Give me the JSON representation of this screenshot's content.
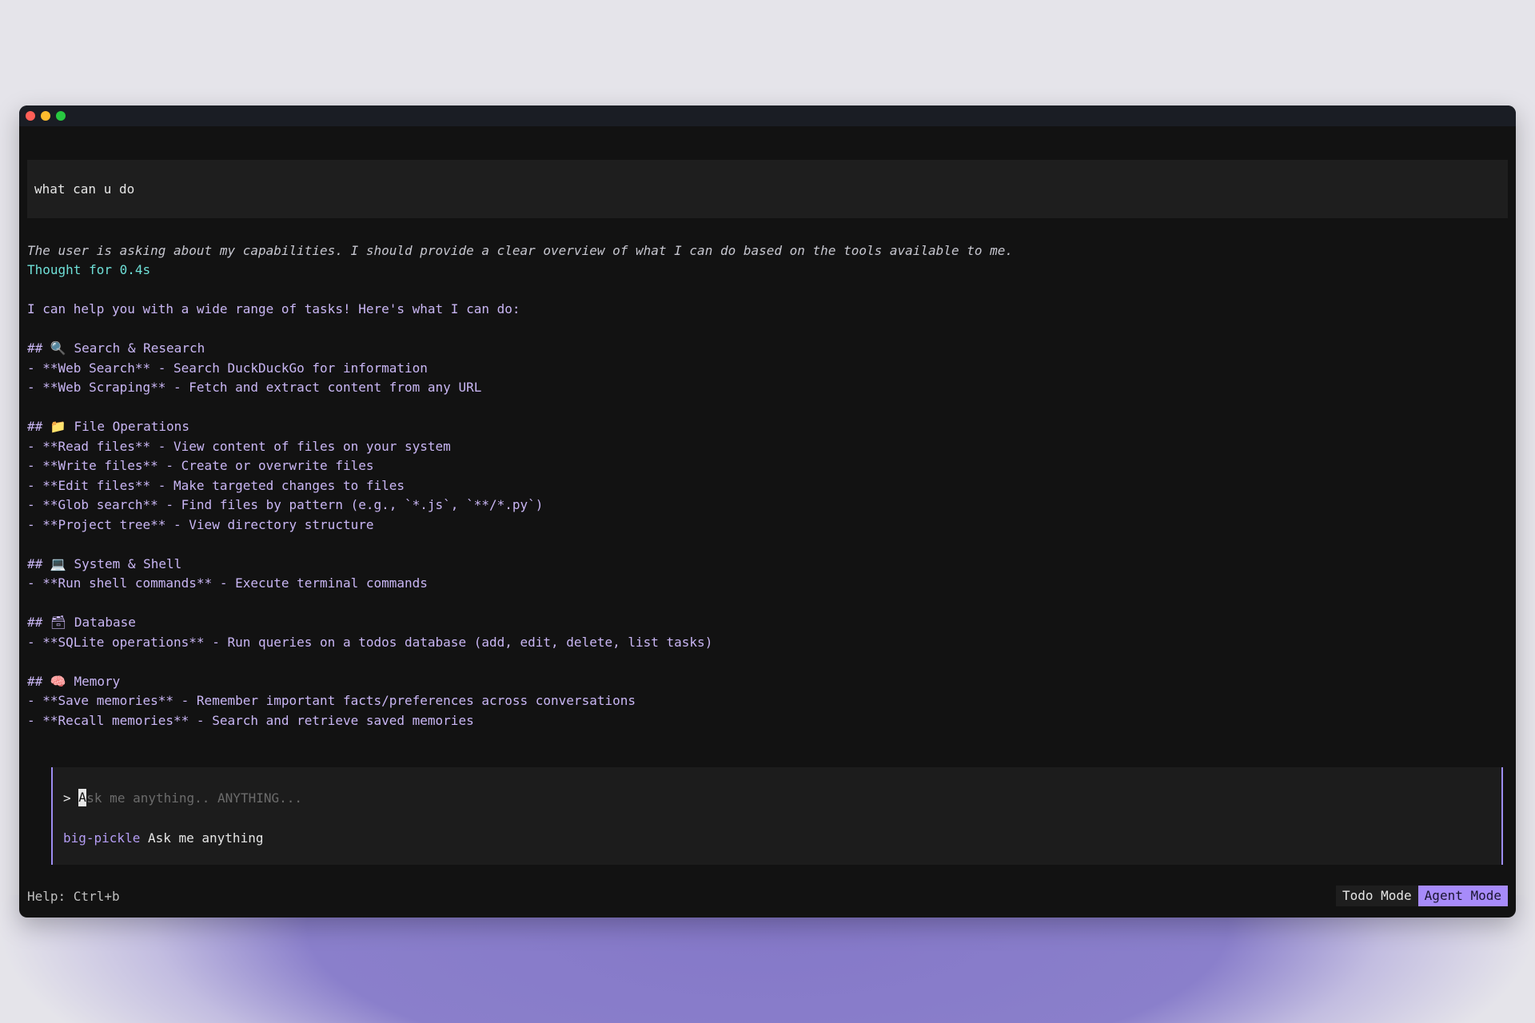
{
  "colors": {
    "accent": "#a78bfa",
    "response_text": "#c9b6f4",
    "thought_time": "#6fe0d8",
    "window_bg": "#121212"
  },
  "conversation": {
    "user_message": "what can u do",
    "thought": "The user is asking about my capabilities. I should provide a clear overview of what I can do based on the tools available to me.",
    "thought_time": "Thought for 0.4s",
    "response_lines": [
      "I can help you with a wide range of tasks! Here's what I can do:",
      "",
      "## 🔍 Search & Research",
      "- **Web Search** - Search DuckDuckGo for information",
      "- **Web Scraping** - Fetch and extract content from any URL",
      "",
      "## 📁 File Operations",
      "- **Read files** - View content of files on your system",
      "- **Write files** - Create or overwrite files",
      "- **Edit files** - Make targeted changes to files",
      "- **Glob search** - Find files by pattern (e.g., `*.js`, `**/*.py`)",
      "- **Project tree** - View directory structure",
      "",
      "## 💻 System & Shell",
      "- **Run shell commands** - Execute terminal commands",
      "",
      "## 🗃 Database",
      "- **SQLite operations** - Run queries on a todos database (add, edit, delete, list tasks)",
      "",
      "## 🧠 Memory",
      "- **Save memories** - Remember important facts/preferences across conversations",
      "- **Recall memories** - Search and retrieve saved memories"
    ]
  },
  "input": {
    "prompt_symbol": ">",
    "cursor_char": "A",
    "placeholder_rest": "sk me anything.. ANYTHING...",
    "model_name": "big-pickle",
    "model_hint": "Ask me anything"
  },
  "footer": {
    "help": "Help: Ctrl+b",
    "todo_mode": "Todo Mode",
    "agent_mode": "Agent Mode"
  }
}
